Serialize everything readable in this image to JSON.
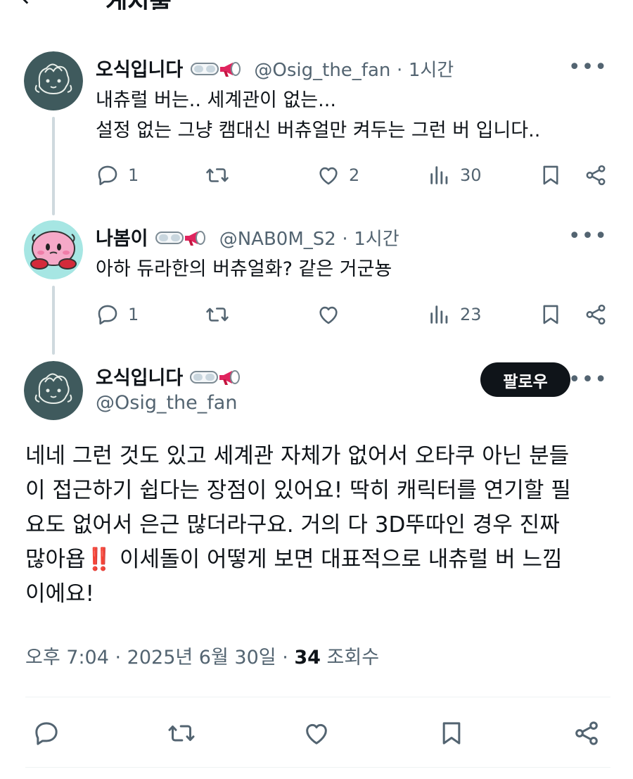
{
  "header": {
    "back_icon": "arrow-left-icon",
    "title": "게시물"
  },
  "thread": [
    {
      "name": "오식입니다",
      "handle": "@Osig_the_fan",
      "time": "1시간",
      "lines": [
        "내츄럴 버는.. 세계관이 없는...",
        "설정 없는 그냥 캠대신 버츄얼만 켜두는 그런 버 입니다.."
      ],
      "replies": "1",
      "reposts": "",
      "likes": "2",
      "views": "30"
    },
    {
      "name": "나봄이",
      "handle": "@NAB0M_S2",
      "time": "1시간",
      "lines": [
        "아하 듀라한의 버츄얼화? 같은 거군뇽"
      ],
      "replies": "1",
      "reposts": "",
      "likes": "",
      "views": "23"
    }
  ],
  "main_post": {
    "name": "오식입니다",
    "handle": "@Osig_the_fan",
    "follow_label": "팔로우",
    "lines": [
      "네네 그런 것도 있고 세계관 자체가 없어서 오타쿠 아닌 분들",
      "이 접근하기 쉽다는 장점이 있어요! 딱히 캐릭터를 연기할 필",
      "요도 없어서 은근 많더라구요. 거의 다 3D뚜따인 경우 진짜",
      "많아욥‼️ 이세돌이 어떻게 보면 대표적으로 내츄럴 버 느낌",
      "이에요!"
    ],
    "time": "오후 7:04",
    "date": "2025년 6월 30일",
    "views": "34",
    "views_label": "조회수"
  },
  "colors": {
    "text": "#0f1419",
    "muted": "#536471",
    "thread_line": "#cfd9de",
    "follow_bg": "#0f1419",
    "megaphone_red": "#e0245e"
  },
  "icons": {
    "reply": "reply-icon",
    "repost": "repost-icon",
    "like": "heart-icon",
    "views": "views-icon",
    "bookmark": "bookmark-icon",
    "share": "share-icon",
    "more": "more-icon",
    "badge": "goggles-megaphone-icon"
  }
}
